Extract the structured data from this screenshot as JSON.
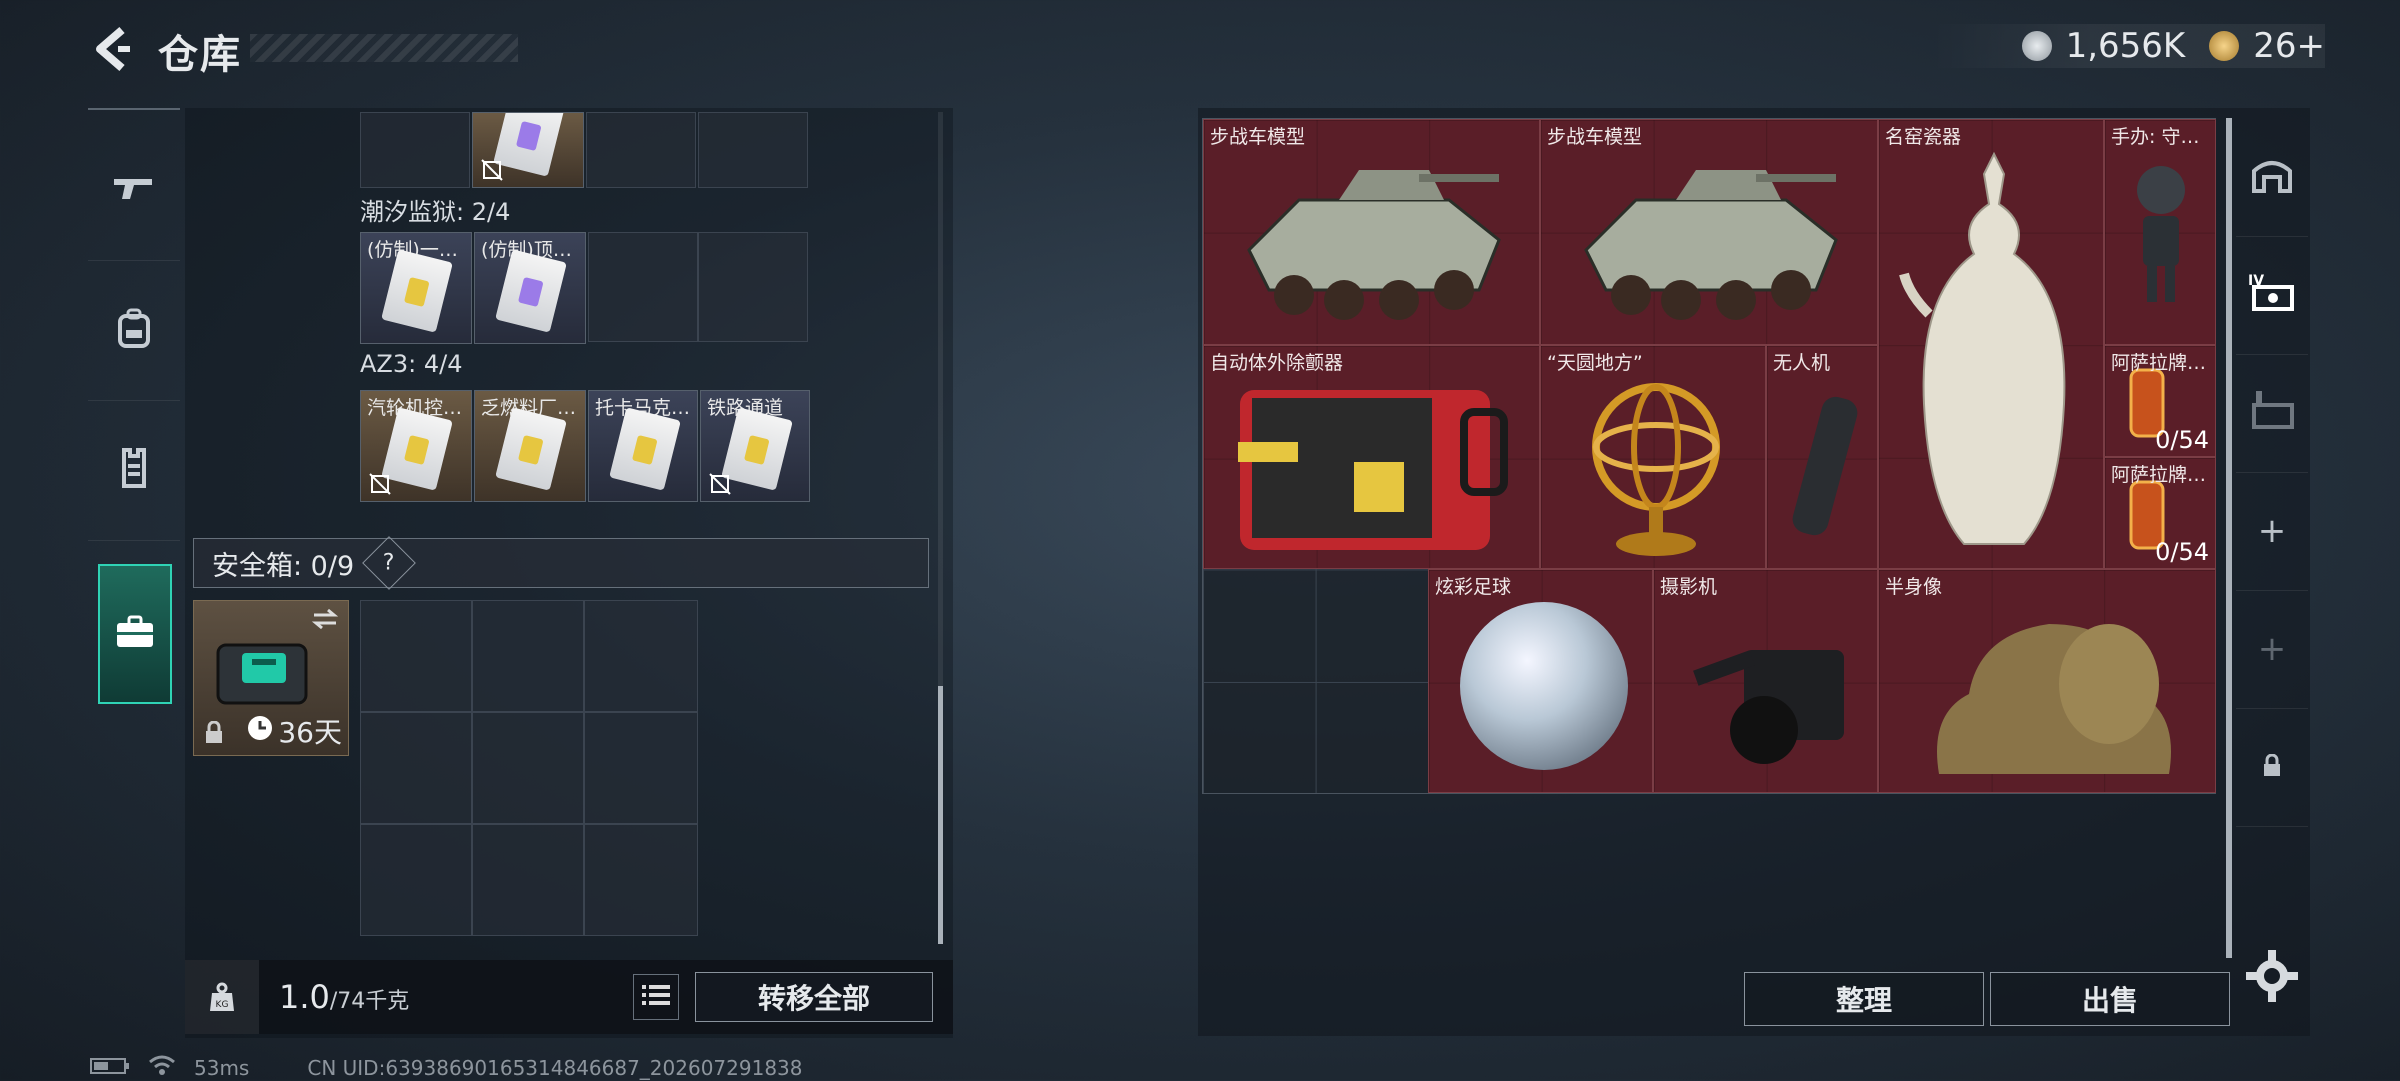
{
  "header": {
    "title": "仓库",
    "currency_silver": "1,656K",
    "currency_gold": "26+"
  },
  "left_nav": [
    "gun-icon",
    "backpack-icon",
    "vest-icon",
    "case-icon"
  ],
  "left": {
    "section1_label": "潮汐监狱: 2/4",
    "section1_cards": [
      {
        "name": "(仿制)一…"
      },
      {
        "name": "(仿制)顶…"
      }
    ],
    "section2_label": "AZ3: 4/4",
    "section2_cards": [
      {
        "name": "汽轮机控…"
      },
      {
        "name": "乏燃料厂…"
      },
      {
        "name": "托卡马克…"
      },
      {
        "name": "铁路通道"
      }
    ],
    "safe_label": "安全箱: 0/9",
    "safe_help": "?",
    "safe_timer": "36天",
    "weight_value": "1.0",
    "weight_max": "/74千克",
    "transfer_all": "转移全部"
  },
  "status": {
    "ping": "53ms",
    "uid": "CN UID:6393869016531484668​7_202607291838"
  },
  "right": {
    "items": [
      {
        "name": "步战车模型"
      },
      {
        "name": "步战车模型"
      },
      {
        "name": "名窑瓷器"
      },
      {
        "name": "手办: 守…"
      },
      {
        "name": "自动体外除颤器"
      },
      {
        "name": "“天圆地方”"
      },
      {
        "name": "无人机"
      },
      {
        "name": "阿萨拉牌…",
        "count": "0/54"
      },
      {
        "name": "阿萨拉牌…",
        "count": "0/54"
      },
      {
        "name": "炫彩足球"
      },
      {
        "name": "摄影机"
      },
      {
        "name": "半身像"
      }
    ],
    "sort_label": "整理",
    "sell_label": "出售"
  }
}
